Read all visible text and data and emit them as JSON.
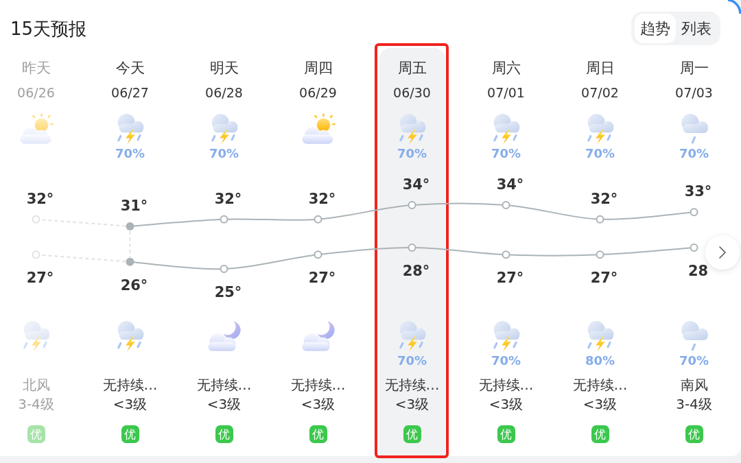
{
  "header": {
    "title": "15天预报",
    "view_toggle": [
      {
        "label": "趋势",
        "selected": true
      },
      {
        "label": "列表",
        "selected": false
      }
    ]
  },
  "days": [
    {
      "name": "昨天",
      "past": true,
      "current": false,
      "selected": false,
      "annotated": false,
      "day_icon": {
        "kind": "partly-cloudy"
      },
      "night_icon": {
        "kind": "thunder-shower"
      },
      "wind_direction": "北风",
      "wind_level": "3-4级",
      "aqi": "优"
    },
    {
      "name": "今天",
      "past": false,
      "current": true,
      "selected": false,
      "annotated": false,
      "day_icon": {
        "kind": "thunder-shower"
      },
      "day_precip": "70%",
      "night_icon": {
        "kind": "thunder-shower"
      },
      "wind_direction": "无持续…",
      "wind_level": "<3级",
      "aqi": "优"
    },
    {
      "name": "明天",
      "past": false,
      "current": false,
      "selected": false,
      "annotated": false,
      "day_icon": {
        "kind": "thunder-shower"
      },
      "day_precip": "70%",
      "night_icon": {
        "kind": "cloudy-night"
      },
      "wind_direction": "无持续…",
      "wind_level": "<3级",
      "aqi": "优"
    },
    {
      "name": "周四",
      "past": false,
      "current": false,
      "selected": false,
      "annotated": false,
      "day_icon": {
        "kind": "partly-cloudy"
      },
      "night_icon": {
        "kind": "cloudy-night"
      },
      "wind_direction": "无持续…",
      "wind_level": "<3级",
      "aqi": "优"
    },
    {
      "name": "周五",
      "past": false,
      "current": false,
      "selected": true,
      "annotated": true,
      "day_icon": {
        "kind": "thunder-shower"
      },
      "day_precip": "70%",
      "night_icon": {
        "kind": "thunder-shower"
      },
      "night_precip": "70%",
      "wind_direction": "无持续…",
      "wind_level": "<3级",
      "aqi": "优"
    },
    {
      "name": "周六",
      "past": false,
      "current": false,
      "selected": false,
      "annotated": false,
      "day_icon": {
        "kind": "thunder-shower"
      },
      "day_precip": "70%",
      "night_icon": {
        "kind": "thunder-shower"
      },
      "night_precip": "70%",
      "wind_direction": "无持续…",
      "wind_level": "<3级",
      "aqi": "优"
    },
    {
      "name": "周日",
      "past": false,
      "current": false,
      "selected": false,
      "annotated": false,
      "day_icon": {
        "kind": "thunder-shower"
      },
      "day_precip": "70%",
      "night_icon": {
        "kind": "thunder-shower"
      },
      "night_precip": "80%",
      "wind_direction": "无持续…",
      "wind_level": "<3级",
      "aqi": "优"
    },
    {
      "name": "周一",
      "past": false,
      "current": false,
      "selected": false,
      "annotated": false,
      "day_icon": {
        "kind": "rain"
      },
      "day_precip": "70%",
      "night_icon": {
        "kind": "rain"
      },
      "night_precip": "70%",
      "wind_direction": "南风",
      "wind_level": "3-4级",
      "aqi": "优"
    }
  ],
  "temperature_chart": {
    "chart_data": [
      {
        "type": "line",
        "categories": [
          "06/26",
          "06/27",
          "06/28",
          "06/29",
          "06/30",
          "07/01",
          "07/02",
          "07/03"
        ],
        "marker": "circle",
        "series": [
          {
            "color": "#dfe2e4",
            "line_style": "dashed",
            "values": [
              32,
              31,
              null,
              null,
              null,
              null,
              null,
              null
            ],
            "value_labels": [
              "32°",
              null,
              null,
              null,
              null,
              null,
              null,
              null
            ]
          },
          {
            "color": "#aab3b8",
            "values": [
              null,
              31,
              32,
              32,
              34,
              34,
              32,
              33
            ],
            "value_labels": [
              null,
              "31°",
              "32°",
              "32°",
              "34°",
              "34°",
              "32°",
              "33°"
            ]
          },
          {
            "color": "#dfe2e4",
            "line_style": "dashed",
            "values": [
              27,
              26,
              null,
              null,
              null,
              null,
              null,
              null
            ],
            "value_labels": [
              "27°",
              null,
              null,
              null,
              null,
              null,
              null,
              null
            ]
          },
          {
            "color": "#aab3b8",
            "values": [
              null,
              26,
              25,
              27,
              28,
              27,
              27,
              28
            ],
            "value_labels": [
              null,
              "26°",
              "25°",
              "27°",
              "28°",
              "27°",
              "27°",
              "28"
            ]
          }
        ]
      }
    ]
  }
}
